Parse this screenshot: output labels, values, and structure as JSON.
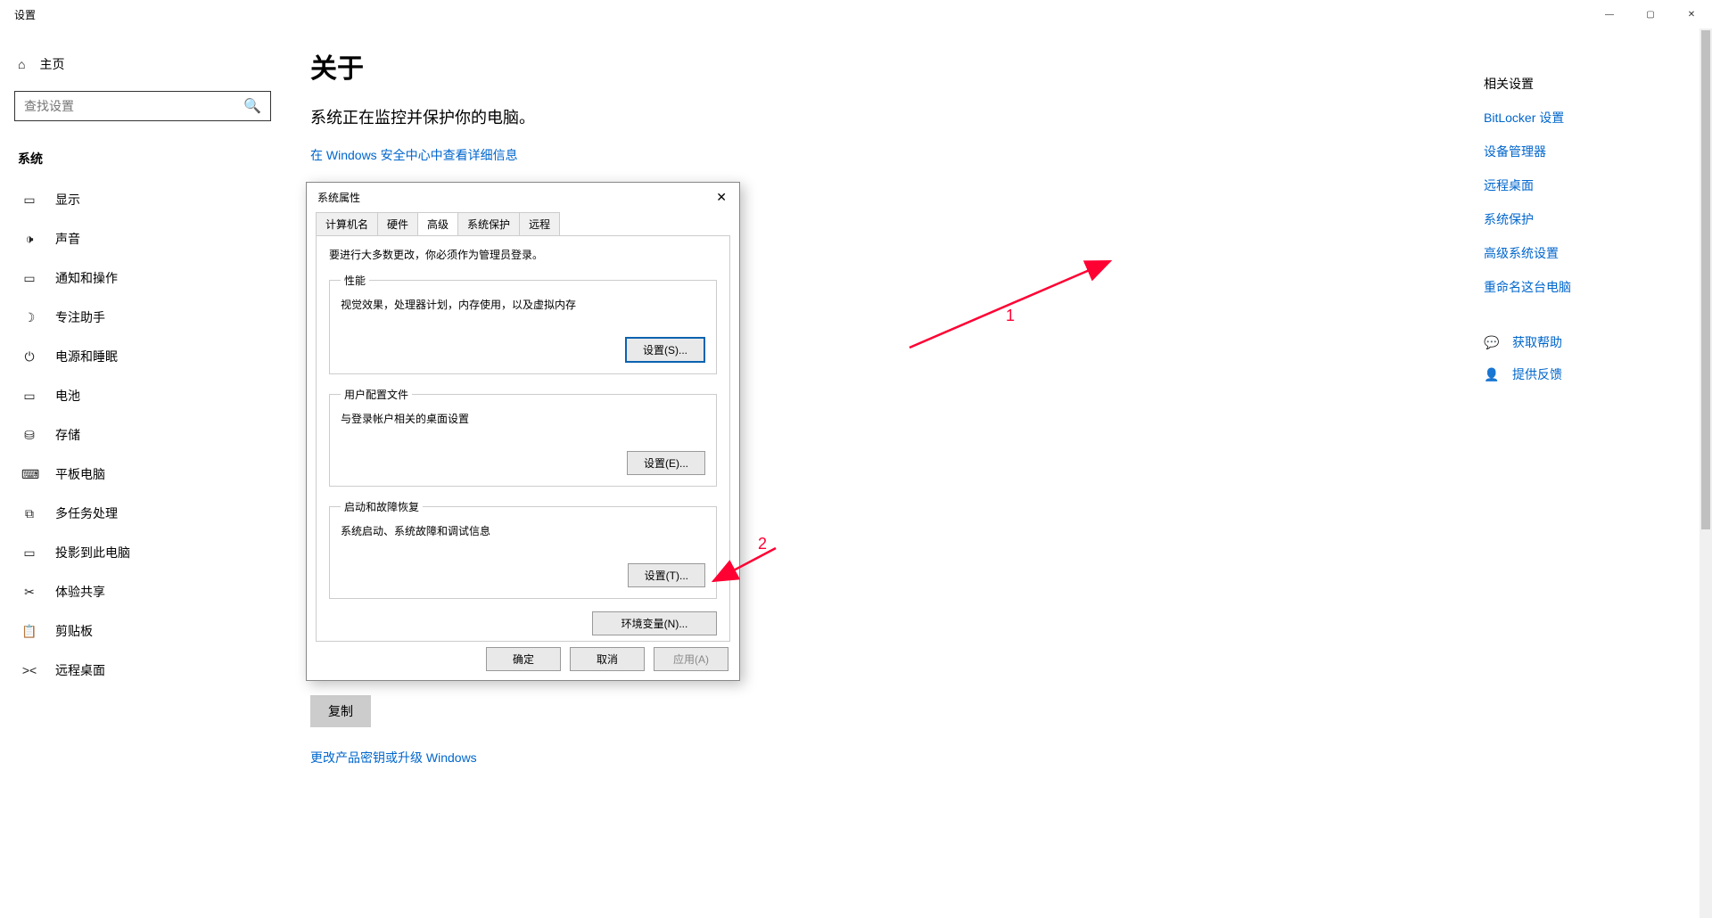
{
  "titlebar": {
    "title": "设置"
  },
  "window_controls": {
    "min": "—",
    "max": "▢",
    "close": "✕"
  },
  "sidebar": {
    "home_label": "主页",
    "search_placeholder": "查找设置",
    "section": "系统",
    "items": [
      {
        "icon": "▭",
        "label": "显示"
      },
      {
        "icon": "🕩",
        "label": "声音"
      },
      {
        "icon": "▭",
        "label": "通知和操作"
      },
      {
        "icon": "☽",
        "label": "专注助手"
      },
      {
        "icon": "⏻",
        "label": "电源和睡眠"
      },
      {
        "icon": "▭",
        "label": "电池"
      },
      {
        "icon": "⛁",
        "label": "存储"
      },
      {
        "icon": "⌨",
        "label": "平板电脑"
      },
      {
        "icon": "⧉",
        "label": "多任务处理"
      },
      {
        "icon": "▭",
        "label": "投影到此电脑"
      },
      {
        "icon": "✂",
        "label": "体验共享"
      },
      {
        "icon": "📋",
        "label": "剪贴板"
      },
      {
        "icon": "><",
        "label": "远程桌面"
      }
    ]
  },
  "main": {
    "heading": "关于",
    "subtitle": "系统正在监控并保护你的电脑。",
    "security_link": "在 Windows 安全中心中查看详细信息",
    "copy_button": "复制",
    "upgrade_link": "更改产品密钥或升级 Windows"
  },
  "right": {
    "title": "相关设置",
    "links": [
      "BitLocker 设置",
      "设备管理器",
      "远程桌面",
      "系统保护",
      "高级系统设置",
      "重命名这台电脑"
    ],
    "actions": [
      {
        "icon": "💬",
        "label": "获取帮助"
      },
      {
        "icon": "👤",
        "label": "提供反馈"
      }
    ]
  },
  "dialog": {
    "title": "系统属性",
    "tabs": [
      "计算机名",
      "硬件",
      "高级",
      "系统保护",
      "远程"
    ],
    "active_tab": "高级",
    "hint": "要进行大多数更改，你必须作为管理员登录。",
    "groups": [
      {
        "legend": "性能",
        "desc": "视觉效果，处理器计划，内存使用，以及虚拟内存",
        "button": "设置(S)...",
        "highlight": true
      },
      {
        "legend": "用户配置文件",
        "desc": "与登录帐户相关的桌面设置",
        "button": "设置(E)...",
        "highlight": false
      },
      {
        "legend": "启动和故障恢复",
        "desc": "系统启动、系统故障和调试信息",
        "button": "设置(T)...",
        "highlight": false
      }
    ],
    "env_button": "环境变量(N)...",
    "ok": "确定",
    "cancel": "取消",
    "apply": "应用(A)"
  },
  "annotations": {
    "label1": "1",
    "label2": "2"
  }
}
